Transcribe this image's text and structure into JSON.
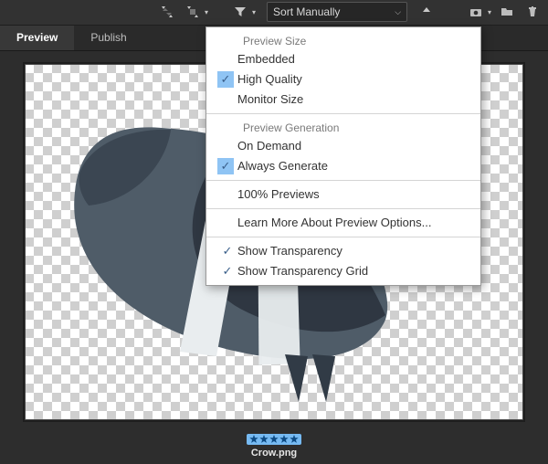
{
  "toolbar": {
    "sort_label": "Sort Manually"
  },
  "tabs": {
    "preview": "Preview",
    "publish": "Publish"
  },
  "file": {
    "name": "Crow.png"
  },
  "menu": {
    "preview_size_header": "Preview Size",
    "embedded": "Embedded",
    "high_quality": "High Quality",
    "monitor_size": "Monitor Size",
    "preview_gen_header": "Preview Generation",
    "on_demand": "On Demand",
    "always_generate": "Always Generate",
    "hundred_percent": "100% Previews",
    "learn_more": "Learn More About Preview Options...",
    "show_transparency": "Show Transparency",
    "show_transparency_grid": "Show Transparency Grid"
  }
}
